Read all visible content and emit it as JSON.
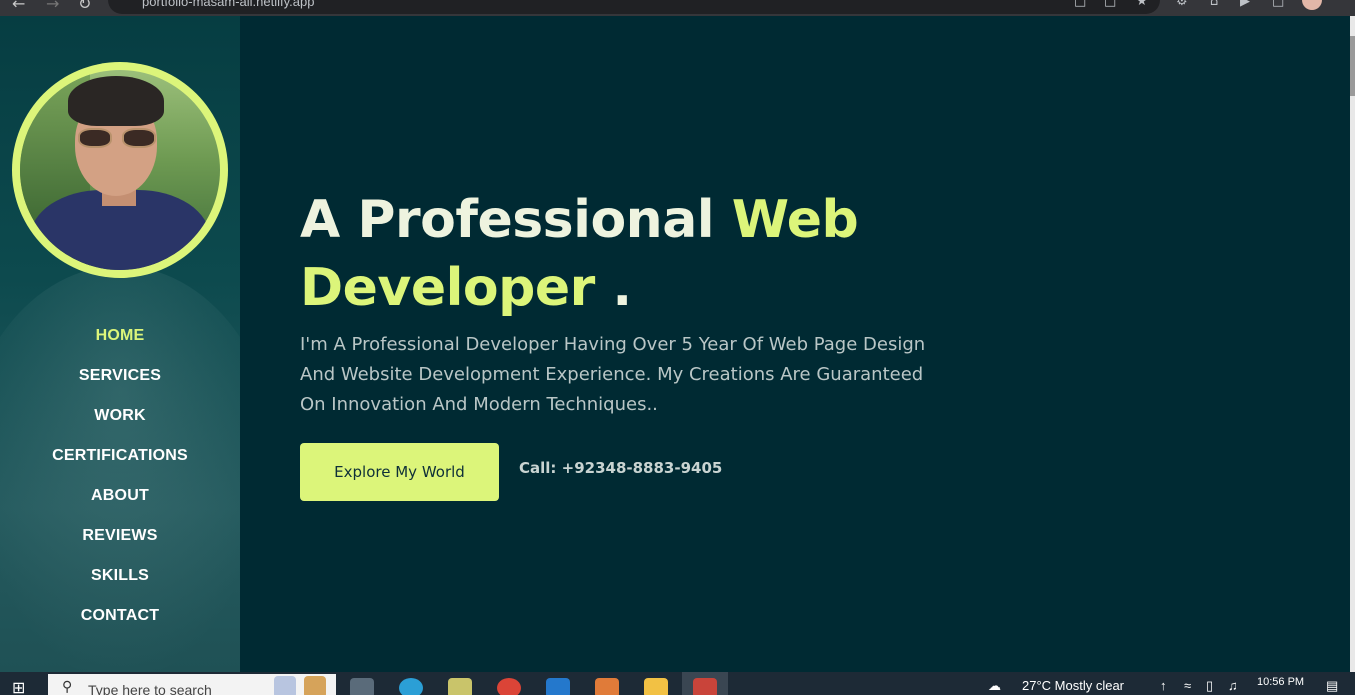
{
  "browser": {
    "url": "portfolio-masam-ali.netlify.app"
  },
  "sidebar": {
    "items": [
      {
        "label": "HOME",
        "active": true
      },
      {
        "label": "SERVICES",
        "active": false
      },
      {
        "label": "WORK",
        "active": false
      },
      {
        "label": "CERTIFICATIONS",
        "active": false
      },
      {
        "label": "ABOUT",
        "active": false
      },
      {
        "label": "REVIEWS",
        "active": false
      },
      {
        "label": "SKILLS",
        "active": false
      },
      {
        "label": "CONTACT",
        "active": false
      }
    ]
  },
  "hero": {
    "title_part1": "A Professional ",
    "title_accent1": "Web",
    "title_accent2": "Developer",
    "title_dot": " .",
    "description": "I'm A Professional Developer Having Over 5 Year Of Web Page Design And Website Development Experience. My Creations Are Guaranteed On Innovation And Modern Techniques..",
    "cta_label": "Explore My World",
    "call_text": "Call: +92348-8883-9405"
  },
  "taskbar": {
    "search_placeholder": "Type here to search",
    "weather": "27°C  Mostly clear",
    "time": "10:56 PM"
  },
  "colors": {
    "accent": "#dcf57a",
    "background": "#002a33",
    "sidebar": "#0d4a4e"
  }
}
